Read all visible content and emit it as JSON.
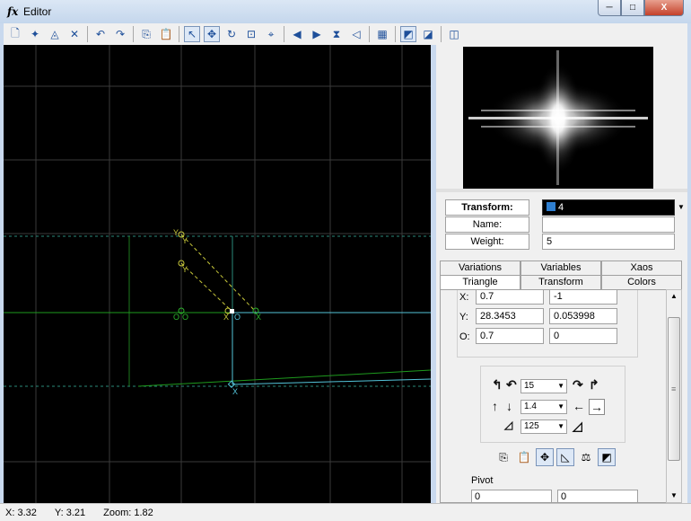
{
  "window": {
    "title": "Editor",
    "app_icon": "fx",
    "buttons": {
      "minimize": "─",
      "maximize": "□",
      "close": "X"
    }
  },
  "toolbar": {
    "groups": [
      [
        {
          "name": "new-icon",
          "glyph": "🗋"
        },
        {
          "name": "new-preset-icon",
          "glyph": "✦"
        },
        {
          "name": "reset-icon",
          "glyph": "◬"
        },
        {
          "name": "delete-icon",
          "glyph": "✕"
        }
      ],
      [
        {
          "name": "undo-icon",
          "glyph": "↶"
        },
        {
          "name": "redo-icon",
          "glyph": "↷"
        }
      ],
      [
        {
          "name": "copy-icon",
          "glyph": "⎘"
        },
        {
          "name": "paste-icon",
          "glyph": "📋"
        }
      ],
      [
        {
          "name": "select-icon",
          "glyph": "↖",
          "pressed": true
        },
        {
          "name": "move-icon",
          "glyph": "✥",
          "pressed": true
        },
        {
          "name": "rotate-icon",
          "glyph": "↻"
        },
        {
          "name": "scale-icon",
          "glyph": "⊡"
        },
        {
          "name": "pivot-icon",
          "glyph": "⌖"
        }
      ],
      [
        {
          "name": "flip-left-icon",
          "glyph": "◀"
        },
        {
          "name": "flip-right-icon",
          "glyph": "▶"
        },
        {
          "name": "flip-h-icon",
          "glyph": "⧗"
        },
        {
          "name": "flip-v-icon",
          "glyph": "◁"
        }
      ],
      [
        {
          "name": "grid-icon",
          "glyph": "▦"
        }
      ],
      [
        {
          "name": "show-triangles-icon",
          "glyph": "◩",
          "pressed": true
        },
        {
          "name": "show-var-icon",
          "glyph": "◪"
        }
      ],
      [
        {
          "name": "settings-icon",
          "glyph": "◫"
        }
      ]
    ]
  },
  "transform": {
    "label": "Transform:",
    "value": "4",
    "name_label": "Name:",
    "name_value": "",
    "weight_label": "Weight:",
    "weight_value": "5"
  },
  "tabs_row1": [
    "Variations",
    "Variables",
    "Xaos"
  ],
  "tabs_row2": [
    "Triangle",
    "Transform",
    "Colors"
  ],
  "active_tab": "Triangle",
  "coords": {
    "x_label": "X:",
    "x1": "0.7",
    "x2": "-1",
    "y_label": "Y:",
    "y1": "28.3453",
    "y2": "0.053998",
    "o_label": "O:",
    "o1": "0.7",
    "o2": "0"
  },
  "controls": {
    "rotate_value": "15",
    "move_value": "1.4",
    "scale_value": "125"
  },
  "pivot": {
    "label": "Pivot",
    "x": "0",
    "y": "0"
  },
  "status": {
    "x": "X: 3.32",
    "y": "Y: 3.21",
    "zoom": "Zoom: 1.82"
  },
  "canvas_labels": {
    "x": "X",
    "y": "Y",
    "o": "O"
  },
  "colors": {
    "canvas_bg": "#000000",
    "grid": "#3a3a3a",
    "green": "#2db52d",
    "cyan": "#53c3d8",
    "yellow": "#c8c83a"
  }
}
